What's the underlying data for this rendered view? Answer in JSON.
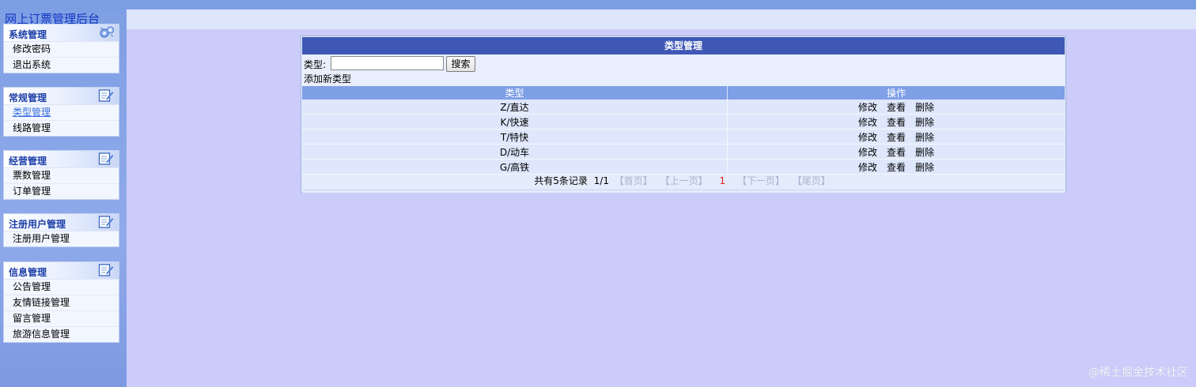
{
  "app": {
    "title": "网上订票管理后台"
  },
  "colors": {
    "top_bar": "#7b9ee3",
    "panel_header": "#3f58b6",
    "table_header": "#7f9fe6",
    "page_background": "#ccccfa",
    "current_page": "#e02020"
  },
  "sidebar": {
    "groups": [
      {
        "label": "系统管理",
        "icon": "gears-icon",
        "items": [
          "修改密码",
          "退出系统"
        ]
      },
      {
        "label": "常规管理",
        "icon": "edit-note-icon",
        "items": [
          "类型管理",
          "线路管理"
        ]
      },
      {
        "label": "经营管理",
        "icon": "edit-note-icon",
        "items": [
          "票数管理",
          "订单管理"
        ]
      },
      {
        "label": "注册用户管理",
        "icon": "edit-note-icon",
        "items": [
          "注册用户管理"
        ]
      },
      {
        "label": "信息管理",
        "icon": "edit-note-icon",
        "items": [
          "公告管理",
          "友情链接管理",
          "留言管理",
          "旅游信息管理"
        ]
      }
    ],
    "active_item": "类型管理"
  },
  "panel": {
    "title": "类型管理",
    "search": {
      "label": "类型:",
      "value": "",
      "placeholder": "",
      "button_label": "搜索"
    },
    "add_link": "添加新类型",
    "table": {
      "columns": [
        "类型",
        "操作"
      ],
      "rows": [
        {
          "type": "Z/直达",
          "actions": [
            "修改",
            "查看",
            "删除"
          ]
        },
        {
          "type": "K/快速",
          "actions": [
            "修改",
            "查看",
            "删除"
          ]
        },
        {
          "type": "T/特快",
          "actions": [
            "修改",
            "查看",
            "删除"
          ]
        },
        {
          "type": "D/动车",
          "actions": [
            "修改",
            "查看",
            "删除"
          ]
        },
        {
          "type": "G/高铁",
          "actions": [
            "修改",
            "查看",
            "删除"
          ]
        }
      ]
    },
    "pager": {
      "info": "共有5条记录",
      "page_of": "1/1",
      "first": "【首页】",
      "prev": "【上一页】",
      "current": "1",
      "next": "【下一页】",
      "last": "【尾页】"
    }
  },
  "watermark": "@稀土掘金技术社区"
}
